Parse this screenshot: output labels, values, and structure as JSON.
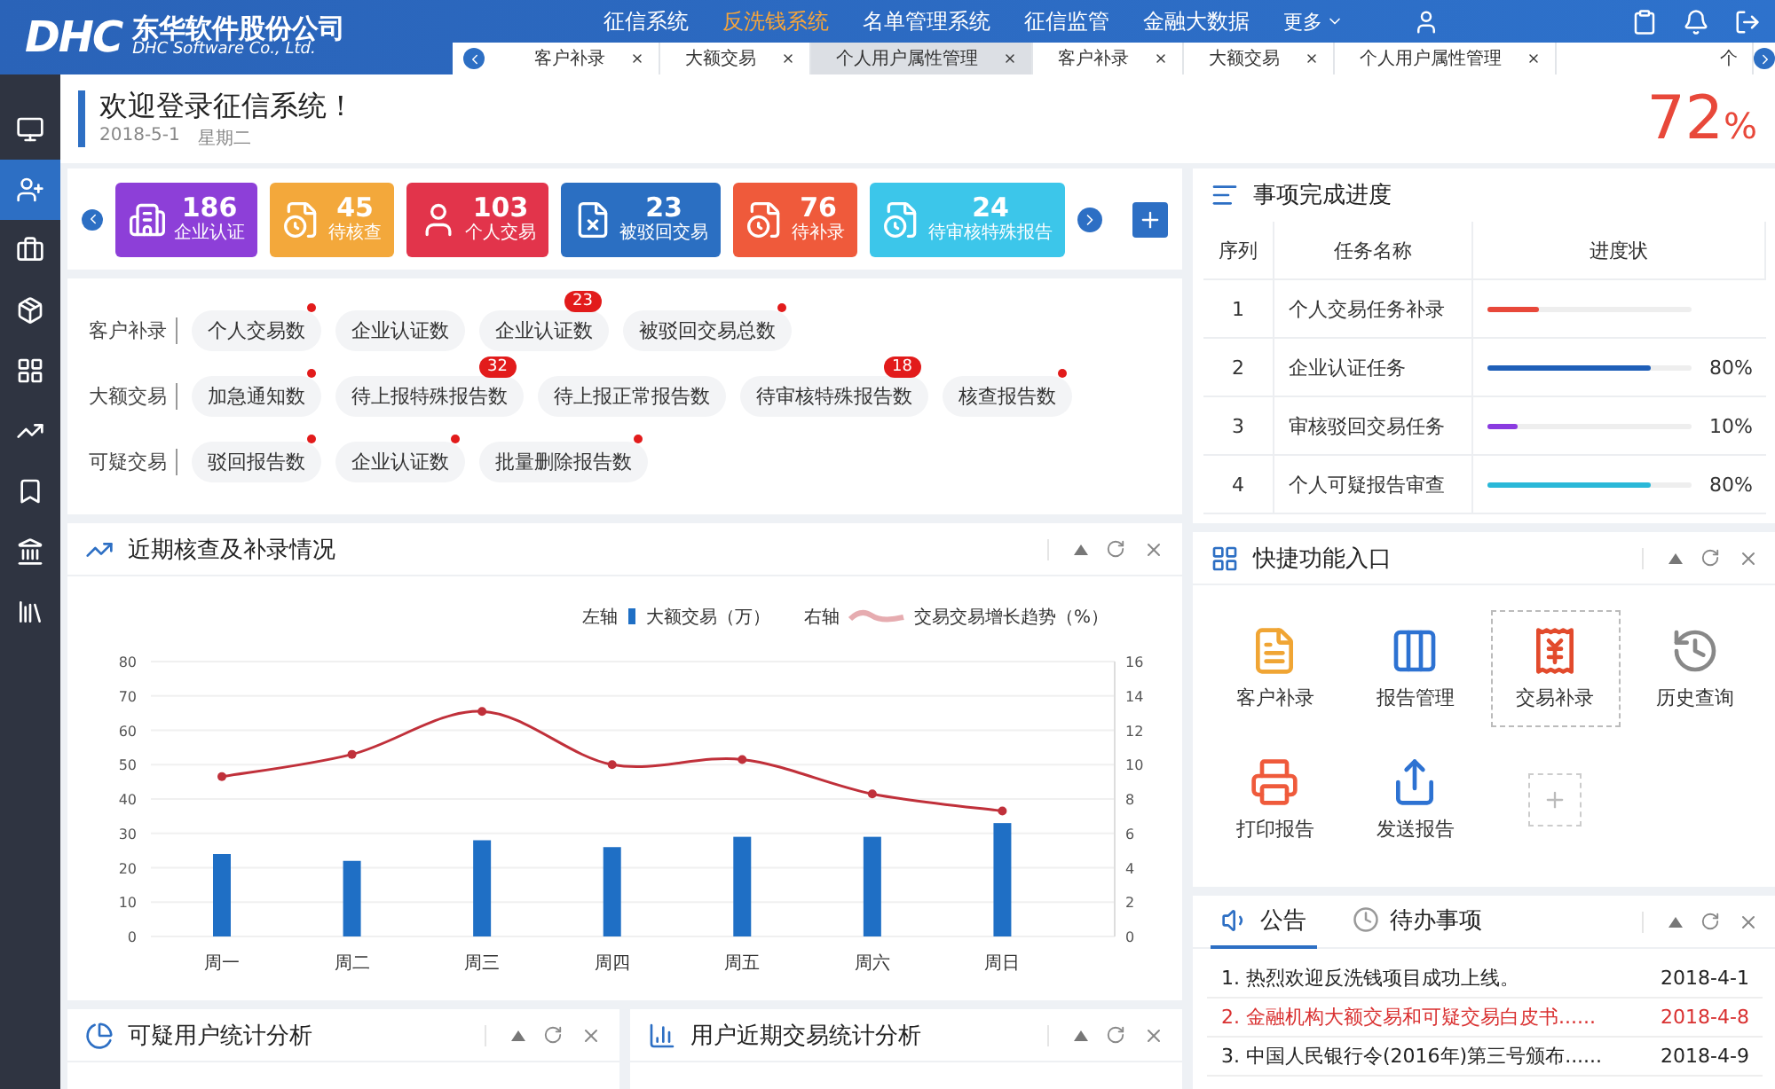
{
  "header": {
    "logo": "DHC",
    "company": "东华软件股份公司",
    "company_en": "DHC Software Co., Ltd.",
    "nav": [
      {
        "label": "征信系统",
        "selected": false
      },
      {
        "label": "反洗钱系统",
        "selected": true
      },
      {
        "label": "名单管理系统",
        "selected": false
      },
      {
        "label": "征信监管",
        "selected": false
      },
      {
        "label": "金融大数据",
        "selected": false
      }
    ],
    "more": "更多"
  },
  "tabs": [
    {
      "label": "客户补录",
      "selected": false
    },
    {
      "label": "大额交易",
      "selected": false
    },
    {
      "label": "个人用户属性管理",
      "selected": true
    },
    {
      "label": "客户补录",
      "selected": false
    },
    {
      "label": "大额交易",
      "selected": false
    },
    {
      "label": "个人用户属性管理",
      "selected": false
    }
  ],
  "tab_cut": "个",
  "sidebar": [
    {
      "kind": "monitor",
      "selected": false
    },
    {
      "kind": "user",
      "selected": true
    },
    {
      "kind": "briefcase",
      "selected": false
    },
    {
      "kind": "box",
      "selected": false
    },
    {
      "kind": "grid",
      "selected": false
    },
    {
      "kind": "chart",
      "selected": false
    },
    {
      "kind": "bookmark",
      "selected": false
    },
    {
      "kind": "bank",
      "selected": false
    },
    {
      "kind": "books",
      "selected": false
    }
  ],
  "welcome": {
    "title": "欢迎登录征信系统！",
    "date": "2018-5-1",
    "weekday": "星期二",
    "stat_value": "72",
    "stat_unit": "%"
  },
  "stat_cards": [
    {
      "kind": "building",
      "count": "186",
      "label": "企业认证",
      "color": "#8d3fd8"
    },
    {
      "kind": "doc-clock",
      "count": "45",
      "label": "待核查",
      "color": "#f3a83b"
    },
    {
      "kind": "person",
      "count": "103",
      "label": "个人交易",
      "color": "#e2344b"
    },
    {
      "kind": "doc-x",
      "count": "23",
      "label": "被驳回交易",
      "color": "#2b6fc2"
    },
    {
      "kind": "doc-clock",
      "count": "76",
      "label": "待补录",
      "color": "#ef5a3b"
    },
    {
      "kind": "doc-clock",
      "count": "24",
      "label": "待审核特殊报告",
      "color": "#3cc6ea"
    }
  ],
  "tag_groups": [
    {
      "label": "客户补录",
      "tags": [
        {
          "label": "个人交易数",
          "dot": true
        },
        {
          "label": "企业认证数",
          "dot": false
        },
        {
          "label": "企业认证数",
          "dot": false,
          "count": "23"
        },
        {
          "label": "被驳回交易总数",
          "dot": true
        }
      ]
    },
    {
      "label": "大额交易",
      "tags": [
        {
          "label": "加急通知数",
          "dot": true
        },
        {
          "label": "待上报特殊报告数",
          "dot": false,
          "count": "32"
        },
        {
          "label": "待上报正常报告数",
          "dot": false
        },
        {
          "label": "待审核特殊报告数",
          "dot": false,
          "count": "18"
        },
        {
          "label": "核查报告数",
          "dot": true
        }
      ]
    },
    {
      "label": "可疑交易",
      "tags": [
        {
          "label": "驳回报告数",
          "dot": true
        },
        {
          "label": "企业认证数",
          "dot": true
        },
        {
          "label": "批量删除报告数",
          "dot": true
        }
      ]
    }
  ],
  "trend_panel": {
    "title": "近期核查及补录情况",
    "axis_labels": [
      "左轴",
      "右轴"
    ],
    "chart_data": {
      "type": "bar",
      "grid": true,
      "categories": [
        "周一",
        "周二",
        "周三",
        "周四",
        "周五",
        "周六",
        "周日"
      ],
      "series": [
        {
          "name": "大额交易（万）",
          "color": "#1f6fc5",
          "values": [
            24,
            22,
            28,
            26,
            29,
            29,
            33
          ]
        }
      ],
      "ylim": [
        0,
        80
      ],
      "yticks": [
        0,
        10,
        20,
        30,
        40,
        50,
        60,
        70,
        80
      ]
    },
    "overlay": {
      "chart_data": {
        "type": "line",
        "series": [
          {
            "name": "交易交易增长趋势（%）",
            "color": "#c0303a",
            "marker": true,
            "values": [
              9.3,
              10.6,
              13.1,
              10,
              10.3,
              8.3,
              7.3
            ]
          }
        ],
        "ylim": [
          0,
          16
        ],
        "yticks": [
          0,
          2,
          4,
          6,
          8,
          10,
          12,
          14,
          16
        ]
      }
    }
  },
  "bottom_panels": [
    {
      "kind": "pie",
      "title": "可疑用户统计分析"
    },
    {
      "kind": "bars",
      "title": "用户近期交易统计分析"
    }
  ],
  "progress": {
    "title": "事项完成进度",
    "columns": [
      "序列",
      "任务名称",
      "进度状"
    ],
    "rows": [
      {
        "index": "1",
        "task": "个人交易任务补录",
        "level": 0.25,
        "color": "#e8483a"
      },
      {
        "index": "2",
        "task": "企业认证任务",
        "level": 0.8,
        "color": "#1f5fb8",
        "percent": "80%"
      },
      {
        "index": "3",
        "task": "审核驳回交易任务",
        "level": 0.15,
        "color": "#8a3be0",
        "percent": "10%"
      },
      {
        "index": "4",
        "task": "个人可疑报告审查",
        "level": 0.8,
        "color": "#2ab8d8",
        "percent": "80%"
      }
    ]
  },
  "quick": {
    "title": "快捷功能入口",
    "items": [
      {
        "kind": "note",
        "label": "客户补录",
        "selected": false
      },
      {
        "kind": "binders",
        "label": "报告管理",
        "selected": false
      },
      {
        "kind": "yen",
        "label": "交易补录",
        "selected": true
      },
      {
        "kind": "history",
        "label": "历史查询",
        "selected": false
      },
      {
        "kind": "printer",
        "label": "打印报告",
        "selected": false
      },
      {
        "kind": "share",
        "label": "发送报告",
        "selected": false
      }
    ]
  },
  "notices": {
    "tabs": [
      {
        "label": "公告",
        "selected": true
      },
      {
        "label": "待办事项",
        "selected": false
      }
    ],
    "items": [
      {
        "text": "1. 热烈欢迎反洗钱项目成功上线。",
        "date": "2018-4-1",
        "highlighted": false
      },
      {
        "text": "2. 金融机构大额交易和可疑交易白皮书......",
        "date": "2018-4-8",
        "highlighted": true
      },
      {
        "text": "3. 中国人民银行令(2016年)第三号颁布......",
        "date": "2018-4-9",
        "highlighted": false
      }
    ]
  }
}
